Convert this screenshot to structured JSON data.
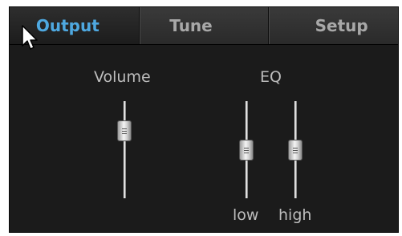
{
  "tabs": [
    {
      "label": "Output",
      "active": true
    },
    {
      "label": "Tune",
      "active": false
    },
    {
      "label": "Setup",
      "active": false
    }
  ],
  "volume": {
    "label": "Volume",
    "level": 0.72
  },
  "eq": {
    "label": "EQ",
    "sliders": [
      {
        "label": "low",
        "level": 0.5
      },
      {
        "label": "high",
        "level": 0.5
      }
    ]
  },
  "colors": {
    "active_tab": "#4ea8e0",
    "inactive_tab": "#a8a8a8",
    "panel_bg": "#1b1b1b",
    "label": "#bdbdbd"
  },
  "icons": {
    "cursor": "mouse-pointer-icon"
  }
}
